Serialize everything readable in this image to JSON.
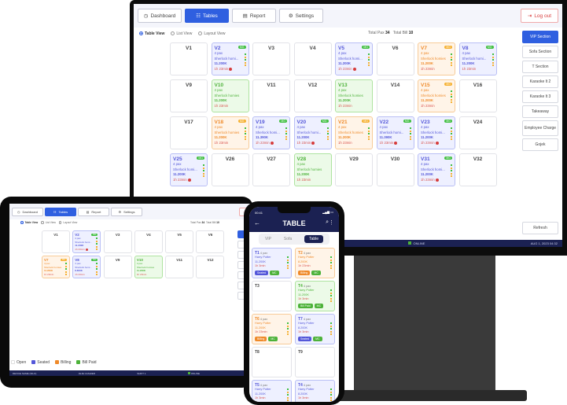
{
  "colors": {
    "seated": "#5457d9",
    "billing": "#ef8a2a",
    "paid": "#4db23a",
    "primary": "#2f5fe0",
    "navy": "#1b2152"
  },
  "monitor": {
    "nav": [
      {
        "label": "Dashboard",
        "icon": "dashboard-icon"
      },
      {
        "label": "Tables",
        "icon": "tables-icon",
        "active": true
      },
      {
        "label": "Report",
        "icon": "report-icon"
      },
      {
        "label": "Settings",
        "icon": "settings-icon"
      }
    ],
    "logout": "Log out",
    "views": [
      "Table View",
      "List View",
      "Layout View"
    ],
    "total_pax_label": "Total Pax",
    "total_pax": "34",
    "total_bill_label": "Total Bill",
    "total_bill": "10",
    "sections": [
      "VIP Section",
      "Sofa Section",
      "T Section",
      "Karaoke lt 2",
      "Karaoke lt 3",
      "Takeaway",
      "Employee Charge",
      "Gojek"
    ],
    "refresh": "Refresh",
    "status": {
      "shift": "SHIFT 1",
      "online": "ONLINE",
      "datetime": "AUG 1, 2023 04:32"
    },
    "tables": [
      {
        "id": "V1",
        "status": "open"
      },
      {
        "id": "V2",
        "status": "seated",
        "pax": "4 pax",
        "name": "Sherlock homi...",
        "amount": "11.200K",
        "time": "1h 23min",
        "badge": "MG",
        "alert": true
      },
      {
        "id": "V3",
        "status": "open"
      },
      {
        "id": "V4",
        "status": "open"
      },
      {
        "id": "V5",
        "status": "seated",
        "pax": "4 pax",
        "name": "Sherlock homi...",
        "amount": "11.200K",
        "time": "1h 23min",
        "badge": "MG",
        "alert": true
      },
      {
        "id": "V6",
        "status": "open"
      },
      {
        "id": "V7",
        "status": "billing",
        "pax": "4 pax",
        "name": "Sherlock homies",
        "amount": "11.200K",
        "time": "1h 23min",
        "badge": "MG"
      },
      {
        "id": "V8",
        "status": "seated",
        "pax": "4 pax",
        "name": "Sherlock homi...",
        "amount": "11.200K",
        "time": "1h 23min",
        "badge": "MG"
      },
      {
        "id": "V9",
        "status": "open"
      },
      {
        "id": "V10",
        "status": "paid",
        "pax": "4 pax",
        "name": "Sherlock homies",
        "amount": "11.200K",
        "time": "1h 23min"
      },
      {
        "id": "V11",
        "status": "open"
      },
      {
        "id": "V12",
        "status": "open"
      },
      {
        "id": "V13",
        "status": "paid",
        "pax": "4 pax",
        "name": "Sherlock homies",
        "amount": "11.200K",
        "time": "1h 23min"
      },
      {
        "id": "V14",
        "status": "open"
      },
      {
        "id": "V15",
        "status": "billing",
        "pax": "4 pax",
        "name": "Sherlock homies",
        "amount": "11.200K",
        "time": "1h 23min",
        "badge": "MG"
      },
      {
        "id": "V16",
        "status": "open"
      },
      {
        "id": "V17",
        "status": "open"
      },
      {
        "id": "V18",
        "status": "billing",
        "pax": "4 pax",
        "name": "Sherlock homies",
        "amount": "11.200K",
        "time": "1h 23min",
        "badge": "MG"
      },
      {
        "id": "V19",
        "status": "seated",
        "pax": "4 pax",
        "name": "Sherlock homi...",
        "amount": "11.390K",
        "time": "1h 23min",
        "badge": "MG",
        "alert": true
      },
      {
        "id": "V20",
        "status": "seated",
        "pax": "4 pax",
        "name": "Sherlock homi...",
        "amount": "11.200K",
        "time": "1h 23min",
        "badge": "MG",
        "alert": true
      },
      {
        "id": "V21",
        "status": "billing",
        "pax": "4 pax",
        "name": "Sherlock homies",
        "amount": "11.200K",
        "time": "1h 23min",
        "badge": "MG"
      },
      {
        "id": "V22",
        "status": "seated",
        "pax": "4 pax",
        "name": "Sherlock homi...",
        "amount": "11.390K",
        "time": "1h 23min",
        "badge": "MG",
        "alert": true
      },
      {
        "id": "V23",
        "status": "seated",
        "pax": "4 pax",
        "name": "Sherlock homi...",
        "amount": "11.200K",
        "time": "1h 23min",
        "badge": "MG",
        "alert": true
      },
      {
        "id": "V24",
        "status": "open"
      },
      {
        "id": "V25",
        "status": "seated",
        "pax": "4 pax",
        "name": "Sherlock homi...",
        "amount": "11.200K",
        "time": "1h 23min",
        "badge": "MG",
        "alert": true
      },
      {
        "id": "V26",
        "status": "open"
      },
      {
        "id": "V27",
        "status": "open"
      },
      {
        "id": "V28",
        "status": "paid",
        "pax": "4 pax",
        "name": "Sherlock homies",
        "amount": "11.200K",
        "time": "1h 23min"
      },
      {
        "id": "V29",
        "status": "open"
      },
      {
        "id": "V30",
        "status": "open"
      },
      {
        "id": "V31",
        "status": "seated",
        "pax": "4 pax",
        "name": "Sherlock homi...",
        "amount": "11.200K",
        "time": "1h 23min",
        "badge": "MG",
        "alert": true
      },
      {
        "id": "V32",
        "status": "open"
      }
    ]
  },
  "tablet": {
    "nav": [
      {
        "label": "Dashboard",
        "icon": "dashboard-icon"
      },
      {
        "label": "Tables",
        "icon": "tables-icon",
        "active": true
      },
      {
        "label": "Report",
        "icon": "report-icon"
      },
      {
        "label": "Settings",
        "icon": "settings-icon"
      }
    ],
    "logout": "Lo",
    "views": [
      "Table View",
      "List View",
      "Layout View"
    ],
    "total_pax_label": "Total Pax",
    "total_pax": "34",
    "total_bill_label": "Total Bill",
    "total_bill": "10",
    "legend": [
      {
        "label": "Open",
        "color": "#ffffff"
      },
      {
        "label": "Seated",
        "color": "#5457d9"
      },
      {
        "label": "Billing",
        "color": "#ef8a2a"
      },
      {
        "label": "Bill Paid",
        "color": "#4db23a"
      }
    ],
    "status": {
      "device": "DEVICE NAME (SILO)",
      "user": "JEJE CASHIER",
      "shift": "SHIFT 1",
      "online": "ONLINE"
    },
    "tables": [
      {
        "id": "V1",
        "status": "open"
      },
      {
        "id": "V2",
        "status": "seated",
        "pax": "4 pax",
        "name": "Sherlock homi...",
        "amount": "11.200K",
        "time": "1h 23min",
        "badge": "MG",
        "alert": true
      },
      {
        "id": "V3",
        "status": "open"
      },
      {
        "id": "V4",
        "status": "open"
      },
      {
        "id": "V5",
        "status": "open"
      },
      {
        "id": "V6",
        "status": "open"
      },
      {
        "id": "V7",
        "status": "billing",
        "pax": "4 pax",
        "name": "Sherlock homies",
        "amount": "11.200K",
        "time": "1h 23min",
        "badge": "MG"
      },
      {
        "id": "V8",
        "status": "seated",
        "pax": "4 pax",
        "name": "Sherlock homi...",
        "amount": "8.800K",
        "time": "1h 23min",
        "badge": "MG"
      },
      {
        "id": "V9",
        "status": "open"
      },
      {
        "id": "V10",
        "status": "paid",
        "pax": "4 pax",
        "name": "Sherlock homies",
        "amount": "11.200K",
        "time": "1h 23min"
      },
      {
        "id": "V11",
        "status": "open"
      },
      {
        "id": "V12",
        "status": "open"
      }
    ]
  },
  "phone": {
    "time": "00:41",
    "title": "TABLE",
    "tabs": [
      "VIP",
      "Sofa",
      "Table"
    ],
    "active_tab": "Table",
    "tables": [
      {
        "id": "T1",
        "status": "seated",
        "pax": "4 pax",
        "name": "Harry Potter",
        "amount": "11.200K",
        "time": "1h 3min",
        "tags": [
          "Seated",
          "MC"
        ]
      },
      {
        "id": "T2",
        "status": "billing",
        "pax": "4 pax",
        "name": "Harry Potter",
        "amount": "8.200K",
        "time": "1h 23min",
        "tags": [
          "Billing",
          "MC"
        ]
      },
      {
        "id": "T3",
        "status": "open"
      },
      {
        "id": "T4",
        "status": "paid",
        "pax": "4 pax",
        "name": "Harry Potter",
        "amount": "11.200K",
        "time": "1h 3min",
        "tags": [
          "Bill Paid",
          "MC"
        ]
      },
      {
        "id": "T6",
        "status": "billing",
        "pax": "4 pax",
        "name": "Harry Potter",
        "amount": "11.200K",
        "time": "1h 23min",
        "tags": [
          "Billing",
          "MC"
        ]
      },
      {
        "id": "T7",
        "status": "seated",
        "pax": "4 pax",
        "name": "Harry Potter",
        "amount": "8.200K",
        "time": "1h 3min",
        "tags": [
          "Seated",
          "MC"
        ]
      },
      {
        "id": "T8",
        "status": "open"
      },
      {
        "id": "T9",
        "status": "open"
      },
      {
        "id": "T5",
        "status": "seated",
        "pax": "4 pax",
        "name": "Harry Potter",
        "amount": "11.200K",
        "time": "1h 3min",
        "tags": []
      },
      {
        "id": "T4",
        "status": "seated",
        "pax": "4 pax",
        "name": "Harry Potter",
        "amount": "8.200K",
        "time": "1h 3min",
        "tags": []
      }
    ]
  }
}
